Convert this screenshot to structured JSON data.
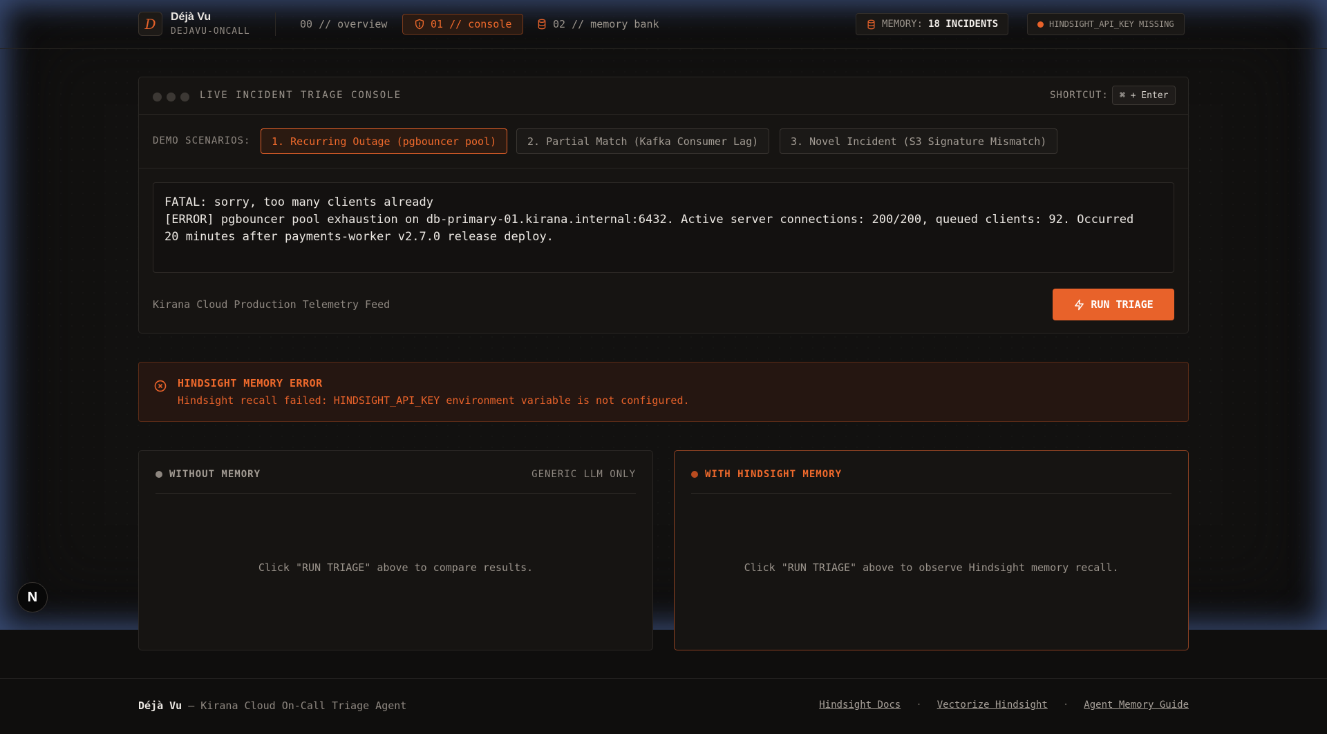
{
  "brand": {
    "logo_letter": "D",
    "title": "Déjà Vu",
    "subtitle": "DEJAVU-ONCALL"
  },
  "nav": [
    {
      "label": "00 // overview",
      "active": false
    },
    {
      "label": "01 // console",
      "active": true,
      "icon": "shield-icon"
    },
    {
      "label": "02 // memory bank",
      "active": false,
      "icon": "database-icon"
    }
  ],
  "status": {
    "memory_label": "MEMORY:",
    "memory_value": "18 INCIDENTS",
    "api_key_status": "HINDSIGHT_API_KEY MISSING"
  },
  "console": {
    "title": "LIVE INCIDENT TRIAGE CONSOLE",
    "shortcut_label": "SHORTCUT:",
    "shortcut_keys": "⌘ + Enter",
    "scenarios_label": "DEMO SCENARIOS:",
    "scenarios": [
      {
        "label": "1. Recurring Outage (pgbouncer pool)",
        "active": true
      },
      {
        "label": "2. Partial Match (Kafka Consumer Lag)",
        "active": false
      },
      {
        "label": "3. Novel Incident (S3 Signature Mismatch)",
        "active": false
      }
    ],
    "log_text": "FATAL: sorry, too many clients already\n[ERROR] pgbouncer pool exhaustion on db-primary-01.kirana.internal:6432. Active server connections: 200/200, queued clients: 92. Occurred\n20 minutes after payments-worker v2.7.0 release deploy.",
    "feed_label": "Kirana Cloud Production Telemetry Feed",
    "run_label": "RUN TRIAGE"
  },
  "error": {
    "title": "HINDSIGHT MEMORY ERROR",
    "message": "Hindsight recall failed: HINDSIGHT_API_KEY environment variable is not configured."
  },
  "panels": {
    "without": {
      "title": "WITHOUT MEMORY",
      "tag": "GENERIC LLM ONLY",
      "empty": "Click \"RUN TRIAGE\" above to compare results."
    },
    "with": {
      "title": "WITH HINDSIGHT MEMORY",
      "empty": "Click \"RUN TRIAGE\" above to observe Hindsight memory recall."
    }
  },
  "footer": {
    "brand": "Déjà Vu",
    "tagline": " — Kirana Cloud On-Call Triage Agent",
    "links": [
      "Hindsight Docs",
      "Vectorize Hindsight",
      "Agent Memory Guide"
    ],
    "separator": "·"
  },
  "colors": {
    "accent": "#e8622a",
    "background": "#121110",
    "glow": "#6084cd"
  },
  "next_badge": "N"
}
